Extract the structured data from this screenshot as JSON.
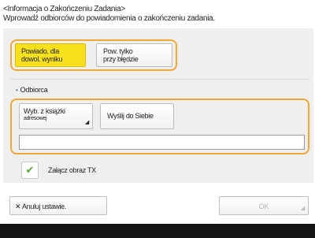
{
  "header": {
    "title": "<Informacja o Zakończeniu Zadania>",
    "instruction": "Wprowadź odbiorców do powiadomienia o zakończeniu zadania."
  },
  "notify_options": {
    "on_result_line1": "Powiado. dla",
    "on_result_line2": "dowol. wyniku",
    "on_error_line1": "Pow. tylko",
    "on_error_line2": "przy błędzie",
    "selected": "on_result"
  },
  "recipient": {
    "section_label": "Odbiorca",
    "address_book_line1": "Wyb. z książki",
    "address_book_line2": "adresowej",
    "send_self_label": "Wyślij do Siebie",
    "field_value": ""
  },
  "attach": {
    "checked": true,
    "label": "Załącz obraz TX"
  },
  "actions": {
    "cancel_label": "Anuluj ustawie.",
    "ok_label": "OK"
  },
  "colors": {
    "selected_button": "#f7e11a",
    "highlight_border": "#f0a733",
    "check": "#58a72a"
  }
}
